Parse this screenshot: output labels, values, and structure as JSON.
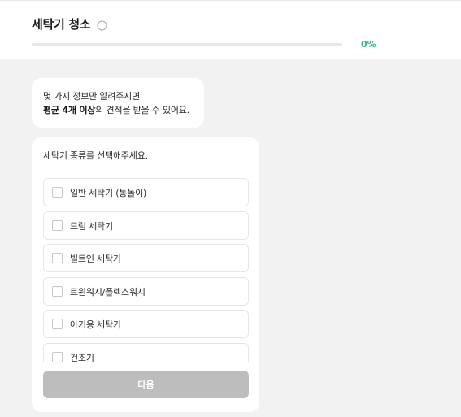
{
  "header": {
    "title": "세탁기 청소",
    "info_icon": "info-circle-icon",
    "progress": {
      "value": 0,
      "label": "0%",
      "accent_color": "#2bb896"
    }
  },
  "intro": {
    "line1": "몇 가지 정보만 알려주시면",
    "line2_strong": "평균 4개 이상",
    "line2_rest": "의 견적을 받을 수 있어요."
  },
  "question": {
    "text": "세탁기 종류를 선택해주세요.",
    "options": [
      {
        "label": "일반 세탁기 (통돌이)",
        "checked": false
      },
      {
        "label": "드럼 세탁기",
        "checked": false
      },
      {
        "label": "빌트인 세탁기",
        "checked": false
      },
      {
        "label": "트윈워시/플렉스워시",
        "checked": false
      },
      {
        "label": "아기용 세탁기",
        "checked": false
      },
      {
        "label": "건조기",
        "checked": false
      }
    ]
  },
  "next_button": {
    "label": "다음",
    "disabled": true,
    "color": "#bdbdbd"
  }
}
